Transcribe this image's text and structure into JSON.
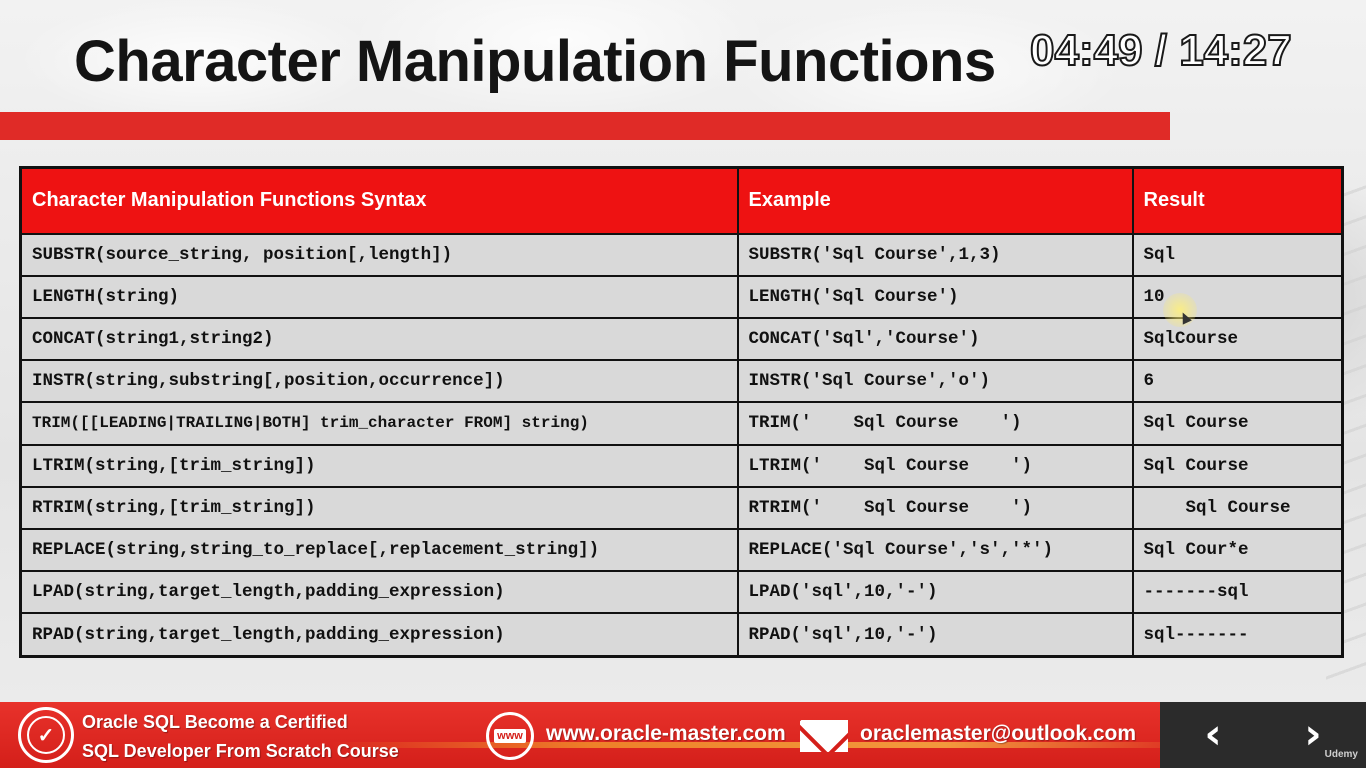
{
  "slide": {
    "title": "Character Manipulation Functions",
    "timer": "04:49 / 14:27"
  },
  "table": {
    "headers": [
      "Character Manipulation Functions Syntax",
      "Example",
      "Result"
    ],
    "rows": [
      [
        "SUBSTR(source_string, position[,length])",
        "SUBSTR('Sql Course',1,3)",
        "Sql"
      ],
      [
        "LENGTH(string)",
        "LENGTH('Sql Course')",
        "10"
      ],
      [
        "CONCAT(string1,string2)",
        "CONCAT('Sql','Course')",
        "SqlCourse"
      ],
      [
        "INSTR(string,substring[,position,occurrence])",
        "INSTR('Sql Course','o')",
        "6"
      ],
      [
        "TRIM([[LEADING|TRAILING|BOTH] trim_character FROM] string)",
        "TRIM('    Sql Course    ')",
        "Sql Course"
      ],
      [
        "LTRIM(string,[trim_string])",
        "LTRIM('    Sql Course    ')",
        "Sql Course"
      ],
      [
        "RTRIM(string,[trim_string])",
        "RTRIM('    Sql Course    ')",
        "    Sql Course"
      ],
      [
        "REPLACE(string,string_to_replace[,replacement_string])",
        "REPLACE('Sql Course','s','*')",
        "Sql Cour*e"
      ],
      [
        "LPAD(string,target_length,padding_expression)",
        "LPAD('sql',10,'-')",
        "-------sql"
      ],
      [
        "RPAD(string,target_length,padding_expression)",
        "RPAD('sql',10,'-')",
        "sql-------"
      ]
    ]
  },
  "footer": {
    "course_line1": "Oracle SQL Become a Certified",
    "course_line2": "SQL  Developer  From Scratch Course",
    "badge_icon": "certified-badge-icon",
    "www_label": "www",
    "website": "www.oracle-master.com",
    "email": "oraclemaster@outlook.com"
  },
  "nav": {
    "prev_label": "‹",
    "next_label": "›",
    "brand": "Udemy"
  },
  "colors": {
    "accent_red": "#e02b27",
    "header_red": "#ee1212",
    "cell_gray": "#d9d9d9",
    "nav_dark": "#2b2b2b"
  }
}
